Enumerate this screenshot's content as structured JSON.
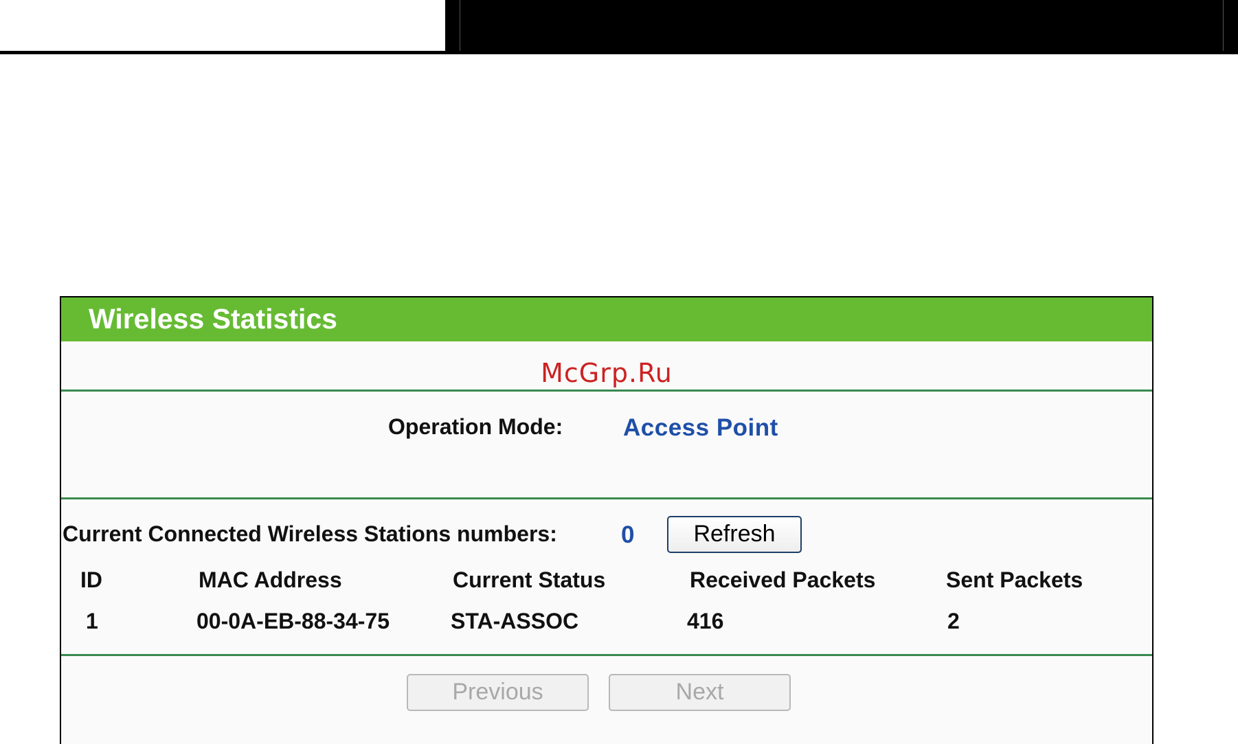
{
  "page": {
    "title": "Wireless Statistics",
    "watermark": "McGrp.Ru"
  },
  "operation": {
    "label": "Operation Mode:",
    "value": "Access Point"
  },
  "stations": {
    "label": "Current Connected Wireless Stations numbers:",
    "count": "0",
    "refresh_label": "Refresh"
  },
  "table": {
    "headers": [
      "ID",
      "MAC Address",
      "Current Status",
      "Received Packets",
      "Sent Packets"
    ],
    "rows": [
      [
        "1",
        "00-0A-EB-88-34-75",
        "STA-ASSOC",
        "416",
        "2"
      ]
    ]
  },
  "pager": {
    "previous_label": "Previous",
    "next_label": "Next"
  },
  "colors": {
    "header_green": "#66bb33",
    "value_blue": "#1f4fa8",
    "separator_green": "#3a8a50",
    "watermark_red": "#cc2222"
  }
}
